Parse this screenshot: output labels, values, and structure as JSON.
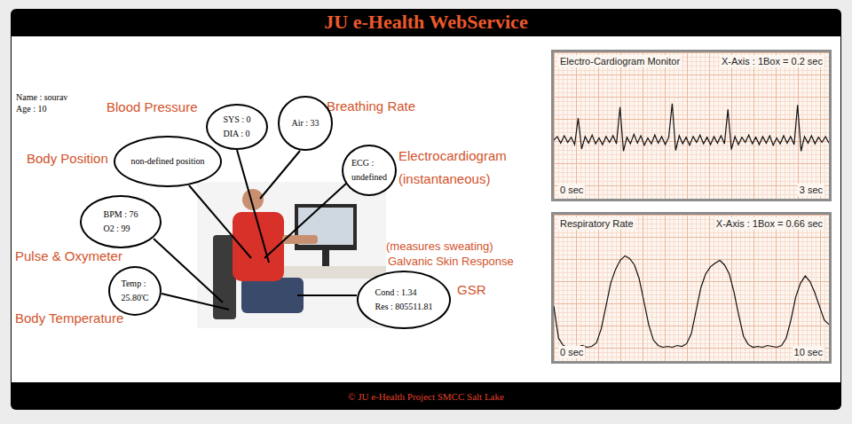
{
  "header": {
    "title": "JU e-Health WebService"
  },
  "patient": {
    "name": "Name : sourav",
    "age": "Age : 10"
  },
  "sensors": [
    {
      "labels": [
        "Blood Pressure"
      ],
      "readings": [
        "SYS : 0",
        "DIA : 0"
      ]
    },
    {
      "labels": [
        "Breathing Rate"
      ],
      "readings": [
        "Air : 33"
      ]
    },
    {
      "labels": [
        "Body Position"
      ],
      "readings": [
        "non-defined position"
      ]
    },
    {
      "labels": [
        "Electrocardiogram",
        "(instantaneous)"
      ],
      "readings": [
        "ECG :",
        "undefined"
      ]
    },
    {
      "labels": [
        "Pulse & Oxymeter"
      ],
      "readings": [
        "BPM : 76",
        "O2 : 99"
      ]
    },
    {
      "labels": [
        "Body Temperature"
      ],
      "readings": [
        "Temp :",
        "25.80'C"
      ]
    },
    {
      "labels": [
        "(measures sweating)",
        "Galvanic Skin Response",
        "GSR"
      ],
      "readings": [
        "Cond : 1.34",
        "Res : 805511.81"
      ]
    }
  ],
  "charts": [
    {
      "title": "Electro-Cardiogram Monitor",
      "scale": "X-Axis : 1Box = 0.2 sec",
      "start": "0 sec",
      "end": "3 sec",
      "values": [
        0,
        0.05,
        -0.04,
        0.06,
        -0.03,
        0.04,
        -0.06,
        0.3,
        -0.12,
        0.05,
        -0.04,
        0.07,
        -0.05,
        0.03,
        -0.06,
        0.05,
        -0.03,
        0.06,
        -0.05,
        0.45,
        -0.15,
        0.04,
        -0.05,
        0.08,
        -0.04,
        0.06,
        -0.07,
        0.03,
        -0.05,
        0.07,
        -0.04,
        0.05,
        -0.06,
        0.04,
        0.5,
        -0.14,
        0.06,
        -0.05,
        0.04,
        -0.07,
        0.05,
        -0.03,
        0.07,
        -0.05,
        0.04,
        -0.06,
        0.05,
        -0.04,
        0.06,
        -0.05,
        0.42,
        -0.13,
        0.05,
        -0.06,
        0.04,
        -0.03,
        0.07,
        -0.05,
        0.04,
        -0.06,
        0.05,
        -0.04,
        0.06,
        -0.07,
        0.03,
        -0.05,
        0.06,
        -0.04,
        0.05,
        -0.06,
        0.48,
        -0.15,
        0.05,
        -0.04,
        0.06,
        -0.05,
        0.04,
        -0.03,
        0.05,
        -0.04
      ]
    },
    {
      "title": "Respiratory Rate",
      "scale": "X-Axis : 1Box = 0.66 sec",
      "start": "0 sec",
      "end": "10 sec",
      "values": [
        0.45,
        0.1,
        0.02,
        0,
        0.01,
        0,
        0.02,
        0,
        0.01,
        0.05,
        0.2,
        0.45,
        0.7,
        0.85,
        0.95,
        1.0,
        0.97,
        0.9,
        0.75,
        0.5,
        0.25,
        0.08,
        0.02,
        0,
        0.01,
        0,
        0.02,
        0.01,
        0.04,
        0.15,
        0.4,
        0.65,
        0.8,
        0.88,
        0.92,
        0.95,
        0.9,
        0.8,
        0.6,
        0.35,
        0.12,
        0.03,
        0,
        0.01,
        0,
        0.02,
        0.01,
        0,
        0.02,
        0.1,
        0.3,
        0.55,
        0.7,
        0.78,
        0.72,
        0.6,
        0.45,
        0.3,
        0.25
      ]
    }
  ],
  "footer": {
    "text": "© JU e-Health Project SMCC Salt Lake"
  }
}
